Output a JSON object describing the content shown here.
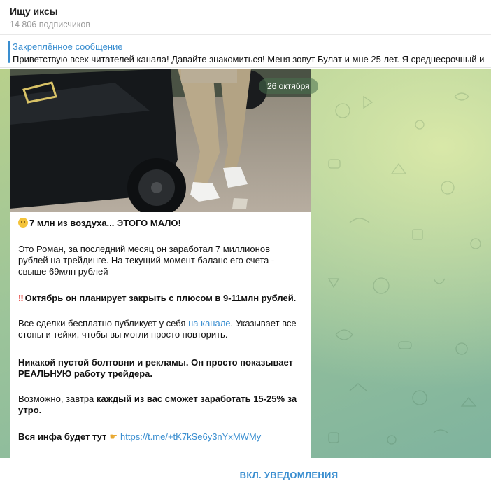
{
  "header": {
    "title": "Ищу иксы",
    "subscribers": "14 806 подписчиков"
  },
  "pinned": {
    "label": "Закреплённое сообщение",
    "text": "Приветствую всех читателей канала! Давайте знакомиться!  Меня зовут Булат и мне 25 лет. Я среднесрочный и"
  },
  "chat": {
    "date_badge": "26 октября"
  },
  "message": {
    "headline": "7 млн из воздуха... ЭТОГО МАЛО!",
    "paragraph1": "Это Роман, за последний месяц он заработал 7 миллионов рублей на трейдинге. На текущий момент баланс его счета - свыше 69млн рублей",
    "highlight": "Октябрь он планирует закрыть с плюсом в 9-11млн рублей.",
    "p3_before": "Все сделки бесплатно публикует у себя ",
    "p3_link": "на канале",
    "p3_after": ". Указывает все стопы и тейки, чтобы вы могли просто повторить.",
    "p4_bold": "Никакой пустой болтовни и рекламы. Он просто показывает РЕАЛЬНУЮ работу трейдера.",
    "p5_before": "Возможно, завтра ",
    "p5_bold": "каждый из вас сможет заработать 15-25% за утро.",
    "p6_bold": "Вся инфа будет тут",
    "p6_link": "https://t.me/+tK7kSe6y3nYxMWMy"
  },
  "footer": {
    "notify_button": "ВКЛ. УВЕДОМЛЕНИЯ"
  },
  "colors": {
    "accent": "#3a8ed0",
    "chat_bg": "#9cc49a"
  }
}
